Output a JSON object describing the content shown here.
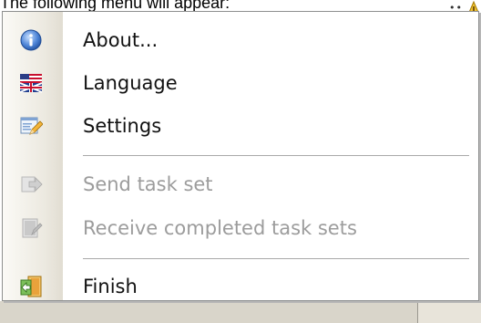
{
  "caption": "The following menu will appear:",
  "menu": {
    "items": [
      {
        "label": "About...",
        "icon": "info-icon",
        "enabled": true
      },
      {
        "label": "Language",
        "icon": "flag-icon",
        "enabled": true
      },
      {
        "label": "Settings",
        "icon": "settings-edit-icon",
        "enabled": true
      },
      {
        "label": "Send task set",
        "icon": "send-arrow-icon",
        "enabled": false
      },
      {
        "label": "Receive completed task sets",
        "icon": "receive-document-icon",
        "enabled": false
      },
      {
        "label": "Finish",
        "icon": "exit-door-icon",
        "enabled": true
      }
    ]
  },
  "colors": {
    "menu_border": "#8e8f8f",
    "gutter": "#ece9e0",
    "disabled_text": "#9c9c9c",
    "taskbar": "#d9d5ca"
  }
}
